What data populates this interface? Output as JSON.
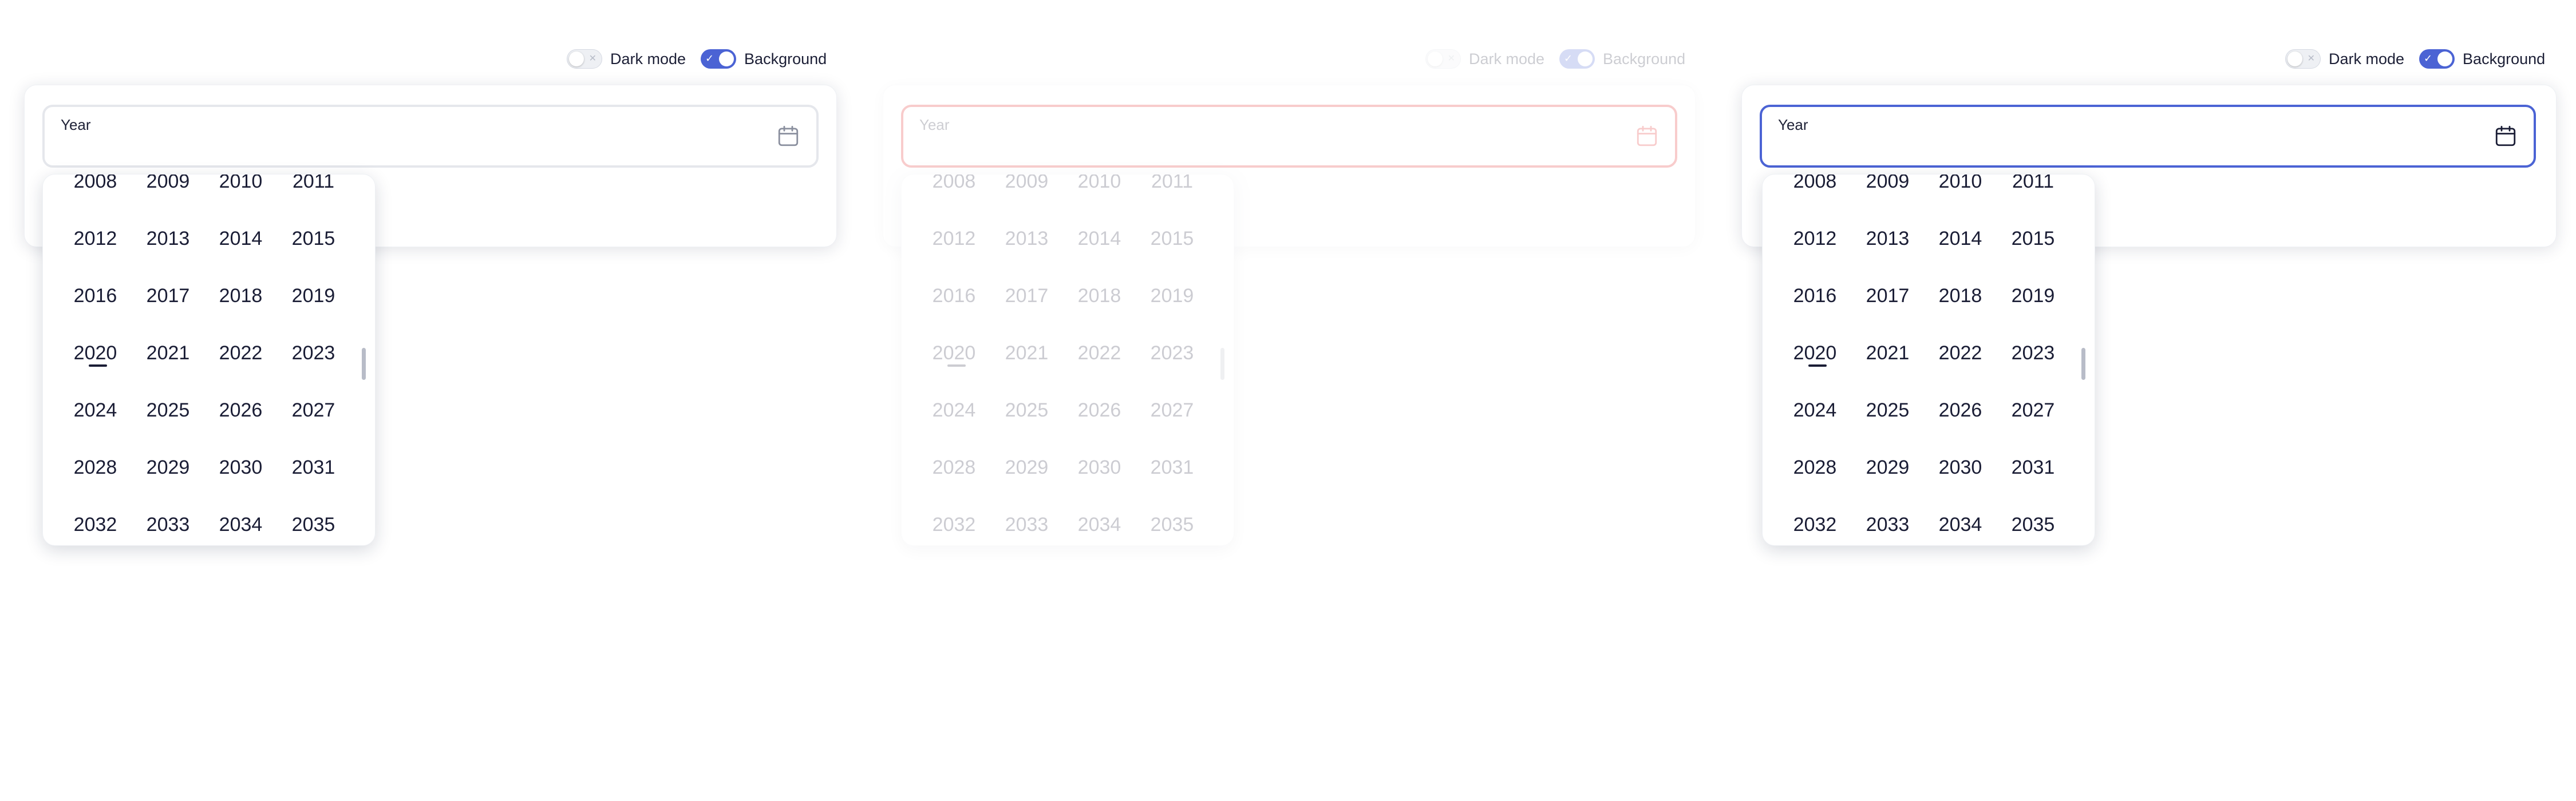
{
  "colors": {
    "accent": "#4b63d4",
    "error": "#e11d1d",
    "text": "#1a1d35",
    "border": "#e5e7ec"
  },
  "panels": [
    {
      "state": "default",
      "toolbar": {
        "dark_mode_label": "Dark mode",
        "dark_mode_on": false,
        "background_label": "Background",
        "background_on": true
      },
      "field": {
        "label": "Year",
        "icon": "calendar-icon"
      },
      "years": [
        [
          "2008",
          "2009",
          "2010",
          "2011"
        ],
        [
          "2012",
          "2013",
          "2014",
          "2015"
        ],
        [
          "2016",
          "2017",
          "2018",
          "2019"
        ],
        [
          "2020",
          "2021",
          "2022",
          "2023"
        ],
        [
          "2024",
          "2025",
          "2026",
          "2027"
        ],
        [
          "2028",
          "2029",
          "2030",
          "2031"
        ],
        [
          "2032",
          "2033",
          "2034",
          "2035"
        ]
      ],
      "current_year": "2020"
    },
    {
      "state": "disabled-error",
      "toolbar": {
        "dark_mode_label": "Dark mode",
        "dark_mode_on": false,
        "background_label": "Background",
        "background_on": true
      },
      "field": {
        "label": "Year",
        "icon": "calendar-icon"
      },
      "years": [
        [
          "2008",
          "2009",
          "2010",
          "2011"
        ],
        [
          "2012",
          "2013",
          "2014",
          "2015"
        ],
        [
          "2016",
          "2017",
          "2018",
          "2019"
        ],
        [
          "2020",
          "2021",
          "2022",
          "2023"
        ],
        [
          "2024",
          "2025",
          "2026",
          "2027"
        ],
        [
          "2028",
          "2029",
          "2030",
          "2031"
        ],
        [
          "2032",
          "2033",
          "2034",
          "2035"
        ]
      ],
      "current_year": "2020"
    },
    {
      "state": "focused",
      "toolbar": {
        "dark_mode_label": "Dark mode",
        "dark_mode_on": false,
        "background_label": "Background",
        "background_on": true
      },
      "field": {
        "label": "Year",
        "icon": "calendar-icon"
      },
      "years": [
        [
          "2008",
          "2009",
          "2010",
          "2011"
        ],
        [
          "2012",
          "2013",
          "2014",
          "2015"
        ],
        [
          "2016",
          "2017",
          "2018",
          "2019"
        ],
        [
          "2020",
          "2021",
          "2022",
          "2023"
        ],
        [
          "2024",
          "2025",
          "2026",
          "2027"
        ],
        [
          "2028",
          "2029",
          "2030",
          "2031"
        ],
        [
          "2032",
          "2033",
          "2034",
          "2035"
        ]
      ],
      "current_year": "2020"
    }
  ]
}
